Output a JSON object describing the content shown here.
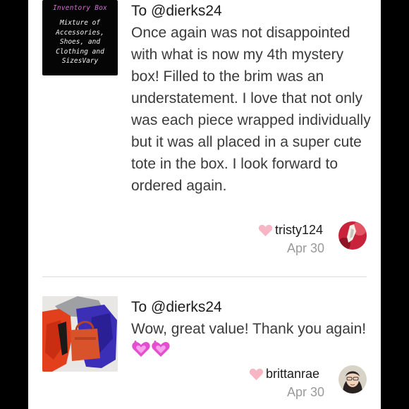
{
  "reviews": [
    {
      "thumb": {
        "title": "Inventory Box",
        "text": "Mixture of\nAccessories,\nShoes, and\nClothing and\nSizesVary"
      },
      "to": "To @dierks24",
      "body": "Once again was not disappointed with what is now my 4th mystery box! Filled to the brim was an understatement. I love that not only was each piece wrapped individually but it was all placed in a super cute tote in the box. I look forward to ordered again.",
      "username": "tristy124",
      "date": "Apr 30"
    },
    {
      "to": "To @dierks24",
      "body": "Wow, great value! Thank you again!",
      "username": "brittanrae",
      "date": "Apr 30"
    }
  ],
  "colors": {
    "heart": "#f7b6c4",
    "thumb_title": "#d46fd0",
    "date": "#9a9a9a"
  },
  "icons": [
    "heart-icon",
    "sparkling-heart-emoji"
  ]
}
